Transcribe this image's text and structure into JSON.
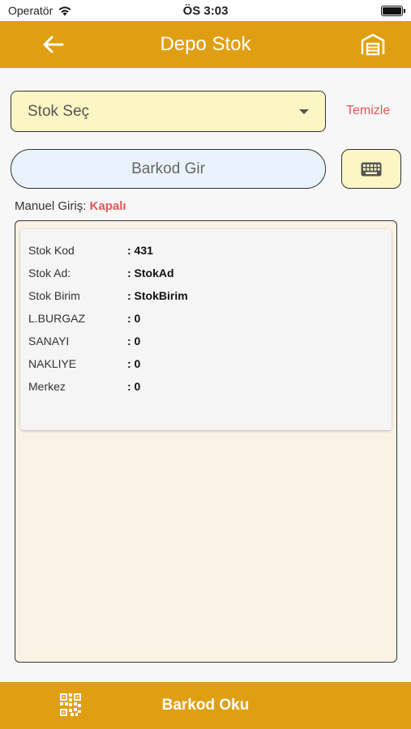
{
  "status_bar": {
    "carrier": "Operatör",
    "time": "ÖS 3:03"
  },
  "header": {
    "title": "Depo Stok",
    "back_icon": "arrow-left-icon",
    "warehouse_icon": "warehouse-icon"
  },
  "stock_select": {
    "placeholder": "Stok Seç",
    "clear_label": "Temizle"
  },
  "barcode": {
    "placeholder": "Barkod Gir",
    "keyboard_icon": "keyboard-icon"
  },
  "manual_entry": {
    "label": "Manuel Giriş:",
    "status": "Kapalı"
  },
  "stock_details": [
    {
      "label": "Stok Kod",
      "value": "431"
    },
    {
      "label": "Stok Ad:",
      "value": "StokAd"
    },
    {
      "label": "Stok Birim",
      "value": "StokBirim"
    },
    {
      "label": "L.BURGAZ",
      "value": "0"
    },
    {
      "label": "SANAYI",
      "value": "0"
    },
    {
      "label": "NAKLIYE",
      "value": "0"
    },
    {
      "label": "Merkez",
      "value": "0"
    }
  ],
  "bottom_bar": {
    "label": "Barkod Oku",
    "icon": "qr-code-icon"
  },
  "colors": {
    "accent": "#e09f12",
    "danger": "#e85656",
    "select_bg": "#fbf6c4",
    "input_bg": "#eaf3fb",
    "panel_bg": "#faf2e4"
  }
}
